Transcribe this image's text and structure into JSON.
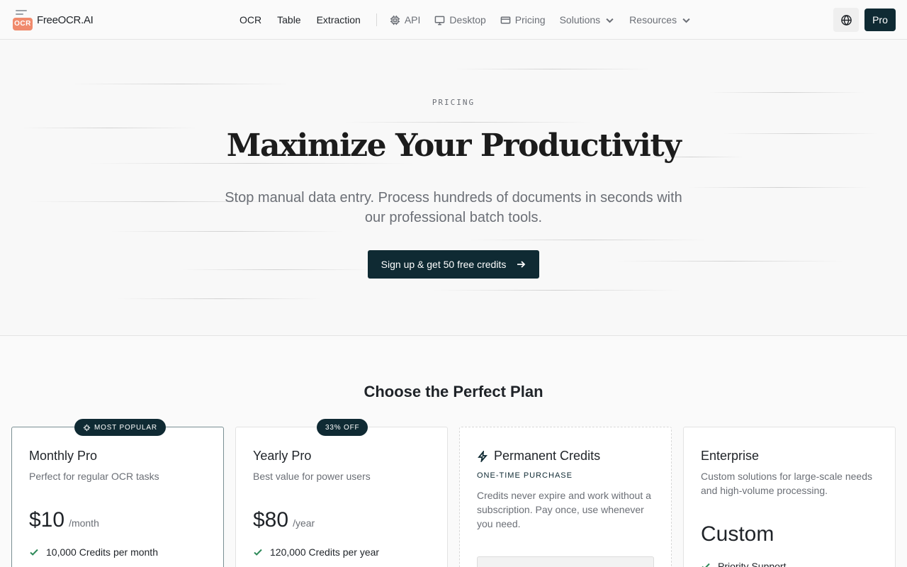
{
  "brand": {
    "name": "FreeOCR.AI",
    "logo_text": "OCR"
  },
  "nav": {
    "primary": [
      "OCR",
      "Table",
      "Extraction"
    ],
    "api": "API",
    "desktop": "Desktop",
    "pricing": "Pricing",
    "solutions": "Solutions",
    "resources": "Resources"
  },
  "header": {
    "pro_label": "Pro"
  },
  "hero": {
    "eyebrow": "PRICING",
    "title": "Maximize Your Productivity",
    "subtitle": "Stop manual data entry. Process hundreds of documents in seconds with our professional batch tools.",
    "cta": "Sign up & get 50 free credits"
  },
  "plans": {
    "title": "Choose the Perfect Plan",
    "monthly": {
      "badge": "MOST POPULAR",
      "name": "Monthly Pro",
      "desc": "Perfect for regular OCR tasks",
      "price": "$10",
      "period": "/month",
      "feature": "10,000 Credits per month"
    },
    "yearly": {
      "badge": "33% OFF",
      "name": "Yearly Pro",
      "desc": "Best value for power users",
      "price": "$80",
      "period": "/year",
      "feature": "120,000 Credits per year"
    },
    "permanent": {
      "name": "Permanent Credits",
      "kicker": "ONE-TIME PURCHASE",
      "desc": "Credits never expire and work without a subscription. Pay once, use whenever you need."
    },
    "enterprise": {
      "name": "Enterprise",
      "desc": "Custom solutions for large-scale needs and high-volume processing.",
      "price": "Custom",
      "feature": "Priority Support"
    }
  },
  "colors": {
    "primary": "#0f2a33",
    "check": "#2f8a5a",
    "logo": "#f08a6c"
  }
}
